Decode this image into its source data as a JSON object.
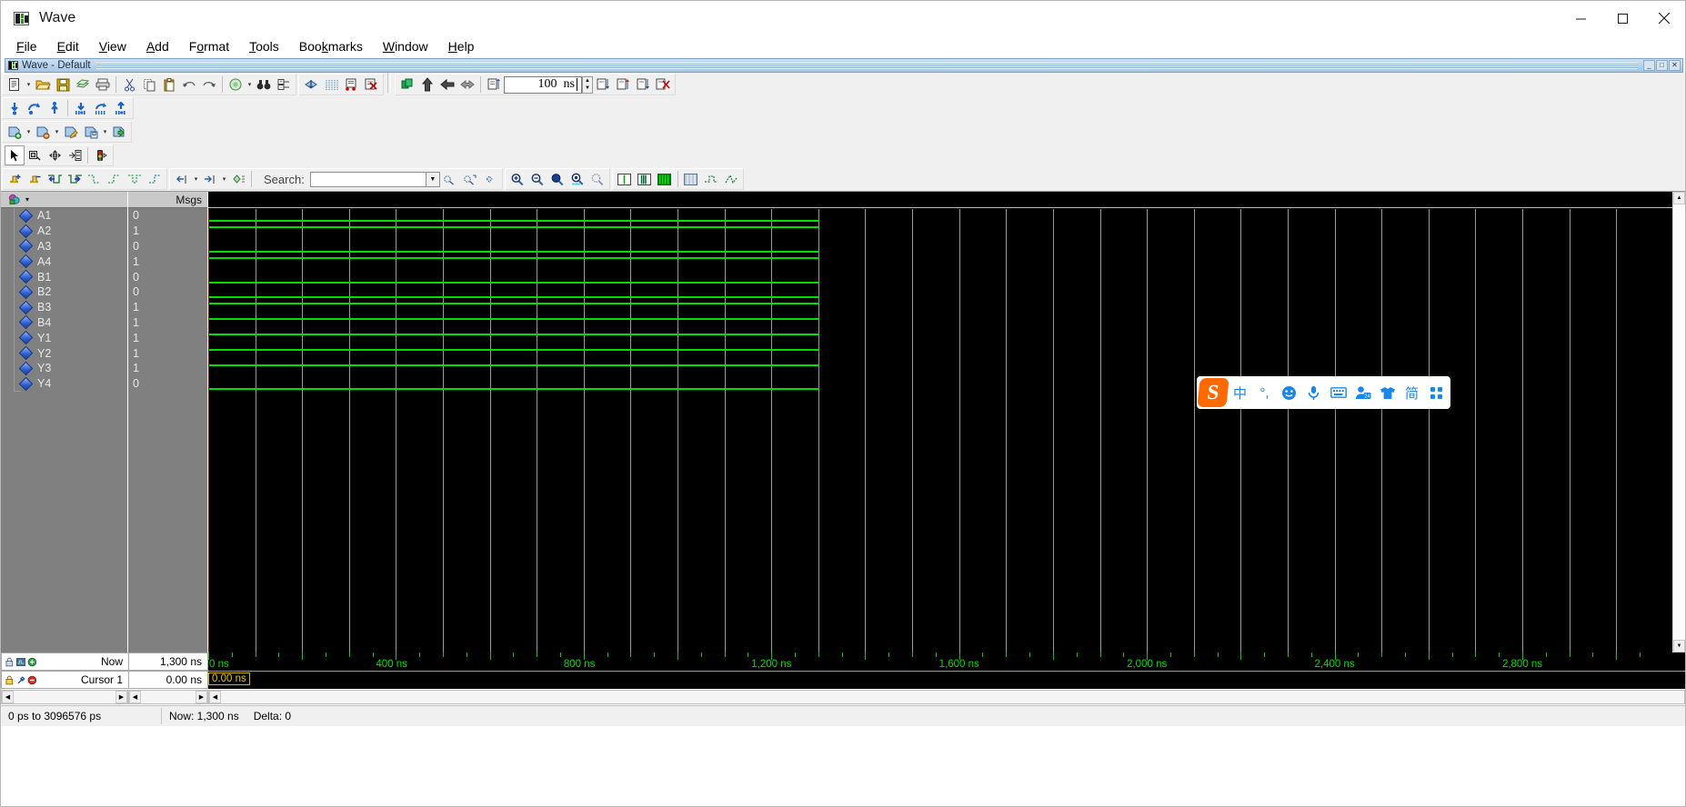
{
  "window": {
    "title": "Wave",
    "icon": "wave-icon",
    "minimize_label": "—",
    "maximize_label": "□",
    "close_label": "✕"
  },
  "menu": {
    "items": [
      {
        "label": "File",
        "accel": "F"
      },
      {
        "label": "Edit",
        "accel": "E"
      },
      {
        "label": "View",
        "accel": "V"
      },
      {
        "label": "Add",
        "accel": "A"
      },
      {
        "label": "Format",
        "accel": "o"
      },
      {
        "label": "Tools",
        "accel": "T"
      },
      {
        "label": "Bookmarks",
        "accel": "k"
      },
      {
        "label": "Window",
        "accel": "W"
      },
      {
        "label": "Help",
        "accel": "H"
      }
    ]
  },
  "mdi": {
    "title": "Wave - Default",
    "minimize": "_",
    "restore": "□",
    "close": "✕"
  },
  "toolbar": {
    "file_group": [
      "new-document-icon",
      "open-folder-icon",
      "save-icon",
      "reload-icon",
      "print-icon"
    ],
    "edit_group": [
      "cut-icon",
      "copy-icon",
      "paste-icon",
      "undo-icon",
      "redo-icon"
    ],
    "find_group": [
      "compile-icon",
      "find-binoculars-icon",
      "expand-tree-icon"
    ],
    "wave_group": [
      "insert-cursor-icon",
      "grid-icon",
      "annotate-icon",
      "delete-wave-icon"
    ],
    "sim_group": [
      "restart-icon",
      "run-icon",
      "continue-icon",
      "run-all-icon"
    ],
    "step_group": [
      "step-icon",
      "step-over-icon",
      "step-out-icon",
      "break-icon"
    ],
    "bookmark_group": [
      "bookmark-add-icon",
      "bookmark-remove-icon",
      "bookmark-edit-icon",
      "bookmark-save-icon",
      "bookmark-goto-icon"
    ],
    "down_group": [
      "down-arrow-icon",
      "rotate-icon",
      "up-arrow-icon",
      "down-to-edge-icon",
      "rotate-edge-icon",
      "up-to-edge-icon"
    ],
    "cursor_group": [
      "select-tool-icon",
      "zoom-box-icon",
      "pan-icon",
      "edit-mode-icon",
      "traffic-light-icon"
    ],
    "cursor_group2": [
      "insert-cursor-add-icon",
      "insert-cursor-del-icon",
      "prev-transition-icon",
      "next-transition-icon",
      "find-falling-icon",
      "find-rising-icon",
      "find-any-icon",
      "find-last-icon"
    ],
    "expand_group": [
      "expand-all-icon",
      "collapse-all-icon",
      "expand-selected-icon"
    ],
    "zoom_group": [
      "zoom-in-icon",
      "zoom-out-icon",
      "zoom-full-icon",
      "zoom-cursor-icon",
      "zoom-range-icon"
    ],
    "format_group": [
      "format-literal-icon",
      "format-analog-icon",
      "format-bus-icon",
      "grid-toggle-icon",
      "radix-icon",
      "wave-style-icon"
    ],
    "run_length": {
      "value": "100",
      "unit": "ns",
      "spin_up": "▲",
      "spin_down": "▼"
    }
  },
  "search": {
    "label": "Search:",
    "value": "",
    "placeholder": "",
    "dropdown_icon": "chevron-down-icon",
    "buttons": [
      "search-prev-icon",
      "search-next-icon",
      "search-options-icon"
    ]
  },
  "wave": {
    "name_header_icon": "objects-icon",
    "name_header_caret": "chevron-down-icon",
    "value_header": "Msgs",
    "signals": [
      {
        "name": "A1",
        "value": "0"
      },
      {
        "name": "A2",
        "value": "1"
      },
      {
        "name": "A3",
        "value": "0"
      },
      {
        "name": "A4",
        "value": "1"
      },
      {
        "name": "B1",
        "value": "0"
      },
      {
        "name": "B2",
        "value": "0"
      },
      {
        "name": "B3",
        "value": "1"
      },
      {
        "name": "B4",
        "value": "1"
      },
      {
        "name": "Y1",
        "value": "1"
      },
      {
        "name": "Y2",
        "value": "1"
      },
      {
        "name": "Y3",
        "value": "1"
      },
      {
        "name": "Y4",
        "value": "0"
      }
    ],
    "trace_color": "#00e000",
    "grid_color": "#9a9a9a",
    "background": "#000000",
    "data_end_ns": 1300,
    "view_start_ns": 0,
    "view_end_ns": 3096.576,
    "time_labels": [
      "0 ns",
      "400 ns",
      "800 ns",
      "1,200 ns",
      "1,600 ns",
      "2,000 ns",
      "2,400 ns",
      "2,800 ns"
    ],
    "time_values_ns": [
      0,
      400,
      800,
      1200,
      1600,
      2000,
      2400,
      2800
    ]
  },
  "footer": {
    "now_label": "Now",
    "now_value": "1,300 ns",
    "cursor_label": "Cursor 1",
    "cursor_value": "0.00 ns",
    "cursor_badge": "0.00 ns",
    "now_icons": [
      "lock-icon",
      "wave-small-icon",
      "add-green-icon"
    ],
    "cursor_icons": [
      "lock-yellow-icon",
      "wrench-icon",
      "remove-red-icon"
    ]
  },
  "status": {
    "range": "0 ps to 3096576 ps",
    "now": "Now: 1,300 ns",
    "delta": "Delta: 0"
  },
  "ime": {
    "logo": "S",
    "items": [
      {
        "icon": "chinese-mode-icon",
        "label": "中"
      },
      {
        "icon": "punctuation-icon",
        "label": "°,"
      },
      {
        "icon": "emoji-icon",
        "label": ""
      },
      {
        "icon": "microphone-icon",
        "label": ""
      },
      {
        "icon": "soft-keyboard-icon",
        "label": ""
      },
      {
        "icon": "user-24-icon",
        "label": ""
      },
      {
        "icon": "skin-shirt-icon",
        "label": ""
      },
      {
        "icon": "simplified-chinese-icon",
        "label": "简"
      },
      {
        "icon": "toolbox-grid-icon",
        "label": ""
      }
    ]
  }
}
